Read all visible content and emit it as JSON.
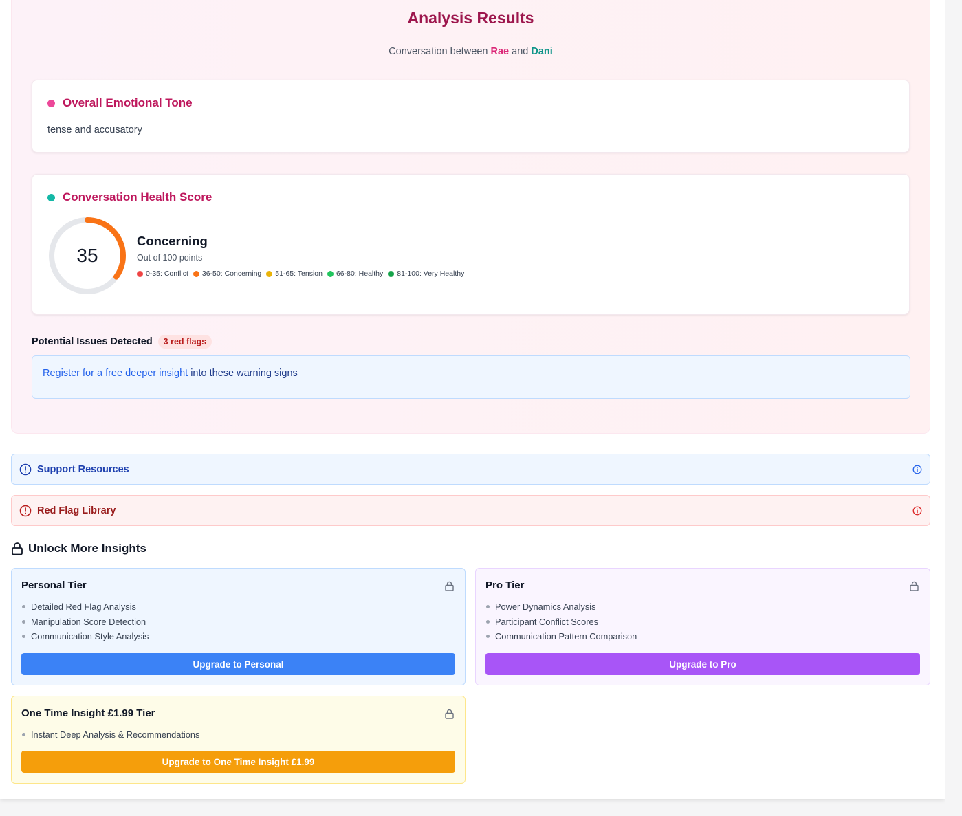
{
  "header": {
    "title": "Analysis Results",
    "subtitle_prefix": "Conversation between",
    "participant_a": "Rae",
    "subtitle_join": "and",
    "participant_b": "Dani"
  },
  "tone": {
    "heading": "Overall Emotional Tone",
    "value": "tense and accusatory",
    "dot_color": "#ec4899"
  },
  "health": {
    "heading": "Conversation Health Score",
    "score": "35",
    "score_value": 35,
    "max_value": 100,
    "label": "Concerning",
    "out_of": "Out of 100 points",
    "dot_color": "#14b8a6",
    "ring_color": "#f97316",
    "legend": [
      {
        "label": "0-35: Conflict",
        "color": "#ef4444"
      },
      {
        "label": "36-50: Concerning",
        "color": "#f97316"
      },
      {
        "label": "51-65: Tension",
        "color": "#eab308"
      },
      {
        "label": "66-80: Healthy",
        "color": "#22c55e"
      },
      {
        "label": "81-100: Very Healthy",
        "color": "#16a34a"
      }
    ]
  },
  "issues": {
    "heading": "Potential Issues Detected",
    "badge": "3 red flags",
    "link_text": "Register for a free deeper insight",
    "after_link": "into these warning signs"
  },
  "accordions": {
    "support": {
      "label": "Support Resources",
      "icon": "alert-circle-icon",
      "info_icon": "info-icon"
    },
    "red_flags": {
      "label": "Red Flag Library",
      "icon": "alert-circle-icon",
      "info_icon": "info-icon"
    }
  },
  "unlock": {
    "heading": "Unlock More Insights",
    "icon": "lock-icon",
    "tiers": [
      {
        "title": "Personal Tier",
        "features": [
          "Detailed Red Flag Analysis",
          "Manipulation Score Detection",
          "Communication Style Analysis"
        ],
        "button": "Upgrade to Personal",
        "color": "#3b82f6"
      },
      {
        "title": "Pro Tier",
        "features": [
          "Power Dynamics Analysis",
          "Participant Conflict Scores",
          "Communication Pattern Comparison"
        ],
        "button": "Upgrade to Pro",
        "color": "#a855f7"
      },
      {
        "title": "One Time Insight £1.99 Tier",
        "features": [
          "Instant Deep Analysis & Recommendations"
        ],
        "button": "Upgrade to One Time Insight £1.99",
        "color": "#f59e0b"
      }
    ]
  }
}
